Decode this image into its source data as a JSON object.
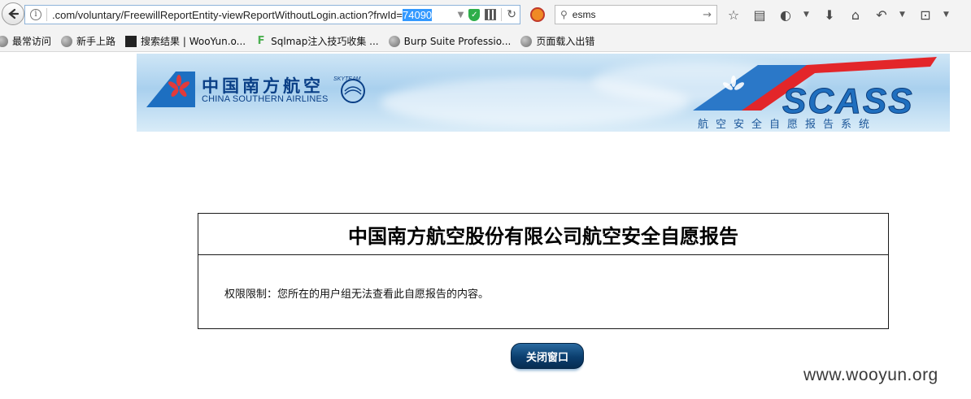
{
  "browser": {
    "url_prefix": ".com/voluntary/FreewillReportEntity-viewReportWithoutLogin.action?frwId=",
    "url_selected": "74090",
    "search_value": "esms"
  },
  "bookmarks": [
    {
      "label": "最常访问",
      "icon": "globe-icon"
    },
    {
      "label": "新手上路",
      "icon": "globe-icon"
    },
    {
      "label": "搜索结果 | WooYun.o...",
      "icon": "wooyun-icon"
    },
    {
      "label": "Sqlmap注入技巧收集 ...",
      "icon": "f-icon"
    },
    {
      "label": "Burp Suite Professio...",
      "icon": "globe-icon"
    },
    {
      "label": "页面载入出错",
      "icon": "globe-icon"
    }
  ],
  "banner": {
    "airline_cn": "中国南方航空",
    "airline_en": "CHINA SOUTHERN AIRLINES",
    "skyteam": "SKYTEAM",
    "system_logo": "SCASS",
    "system_name": "航空安全自愿报告系统"
  },
  "report": {
    "title": "中国南方航空股份有限公司航空安全自愿报告",
    "message": "权限限制：您所在的用户组无法查看此自愿报告的内容。"
  },
  "close_button": {
    "label": "关闭窗口"
  },
  "watermark": "www.wooyun.org",
  "colors": {
    "accent": "#0a3f86",
    "button": "#0b3e6e",
    "selection": "#3399ff"
  }
}
